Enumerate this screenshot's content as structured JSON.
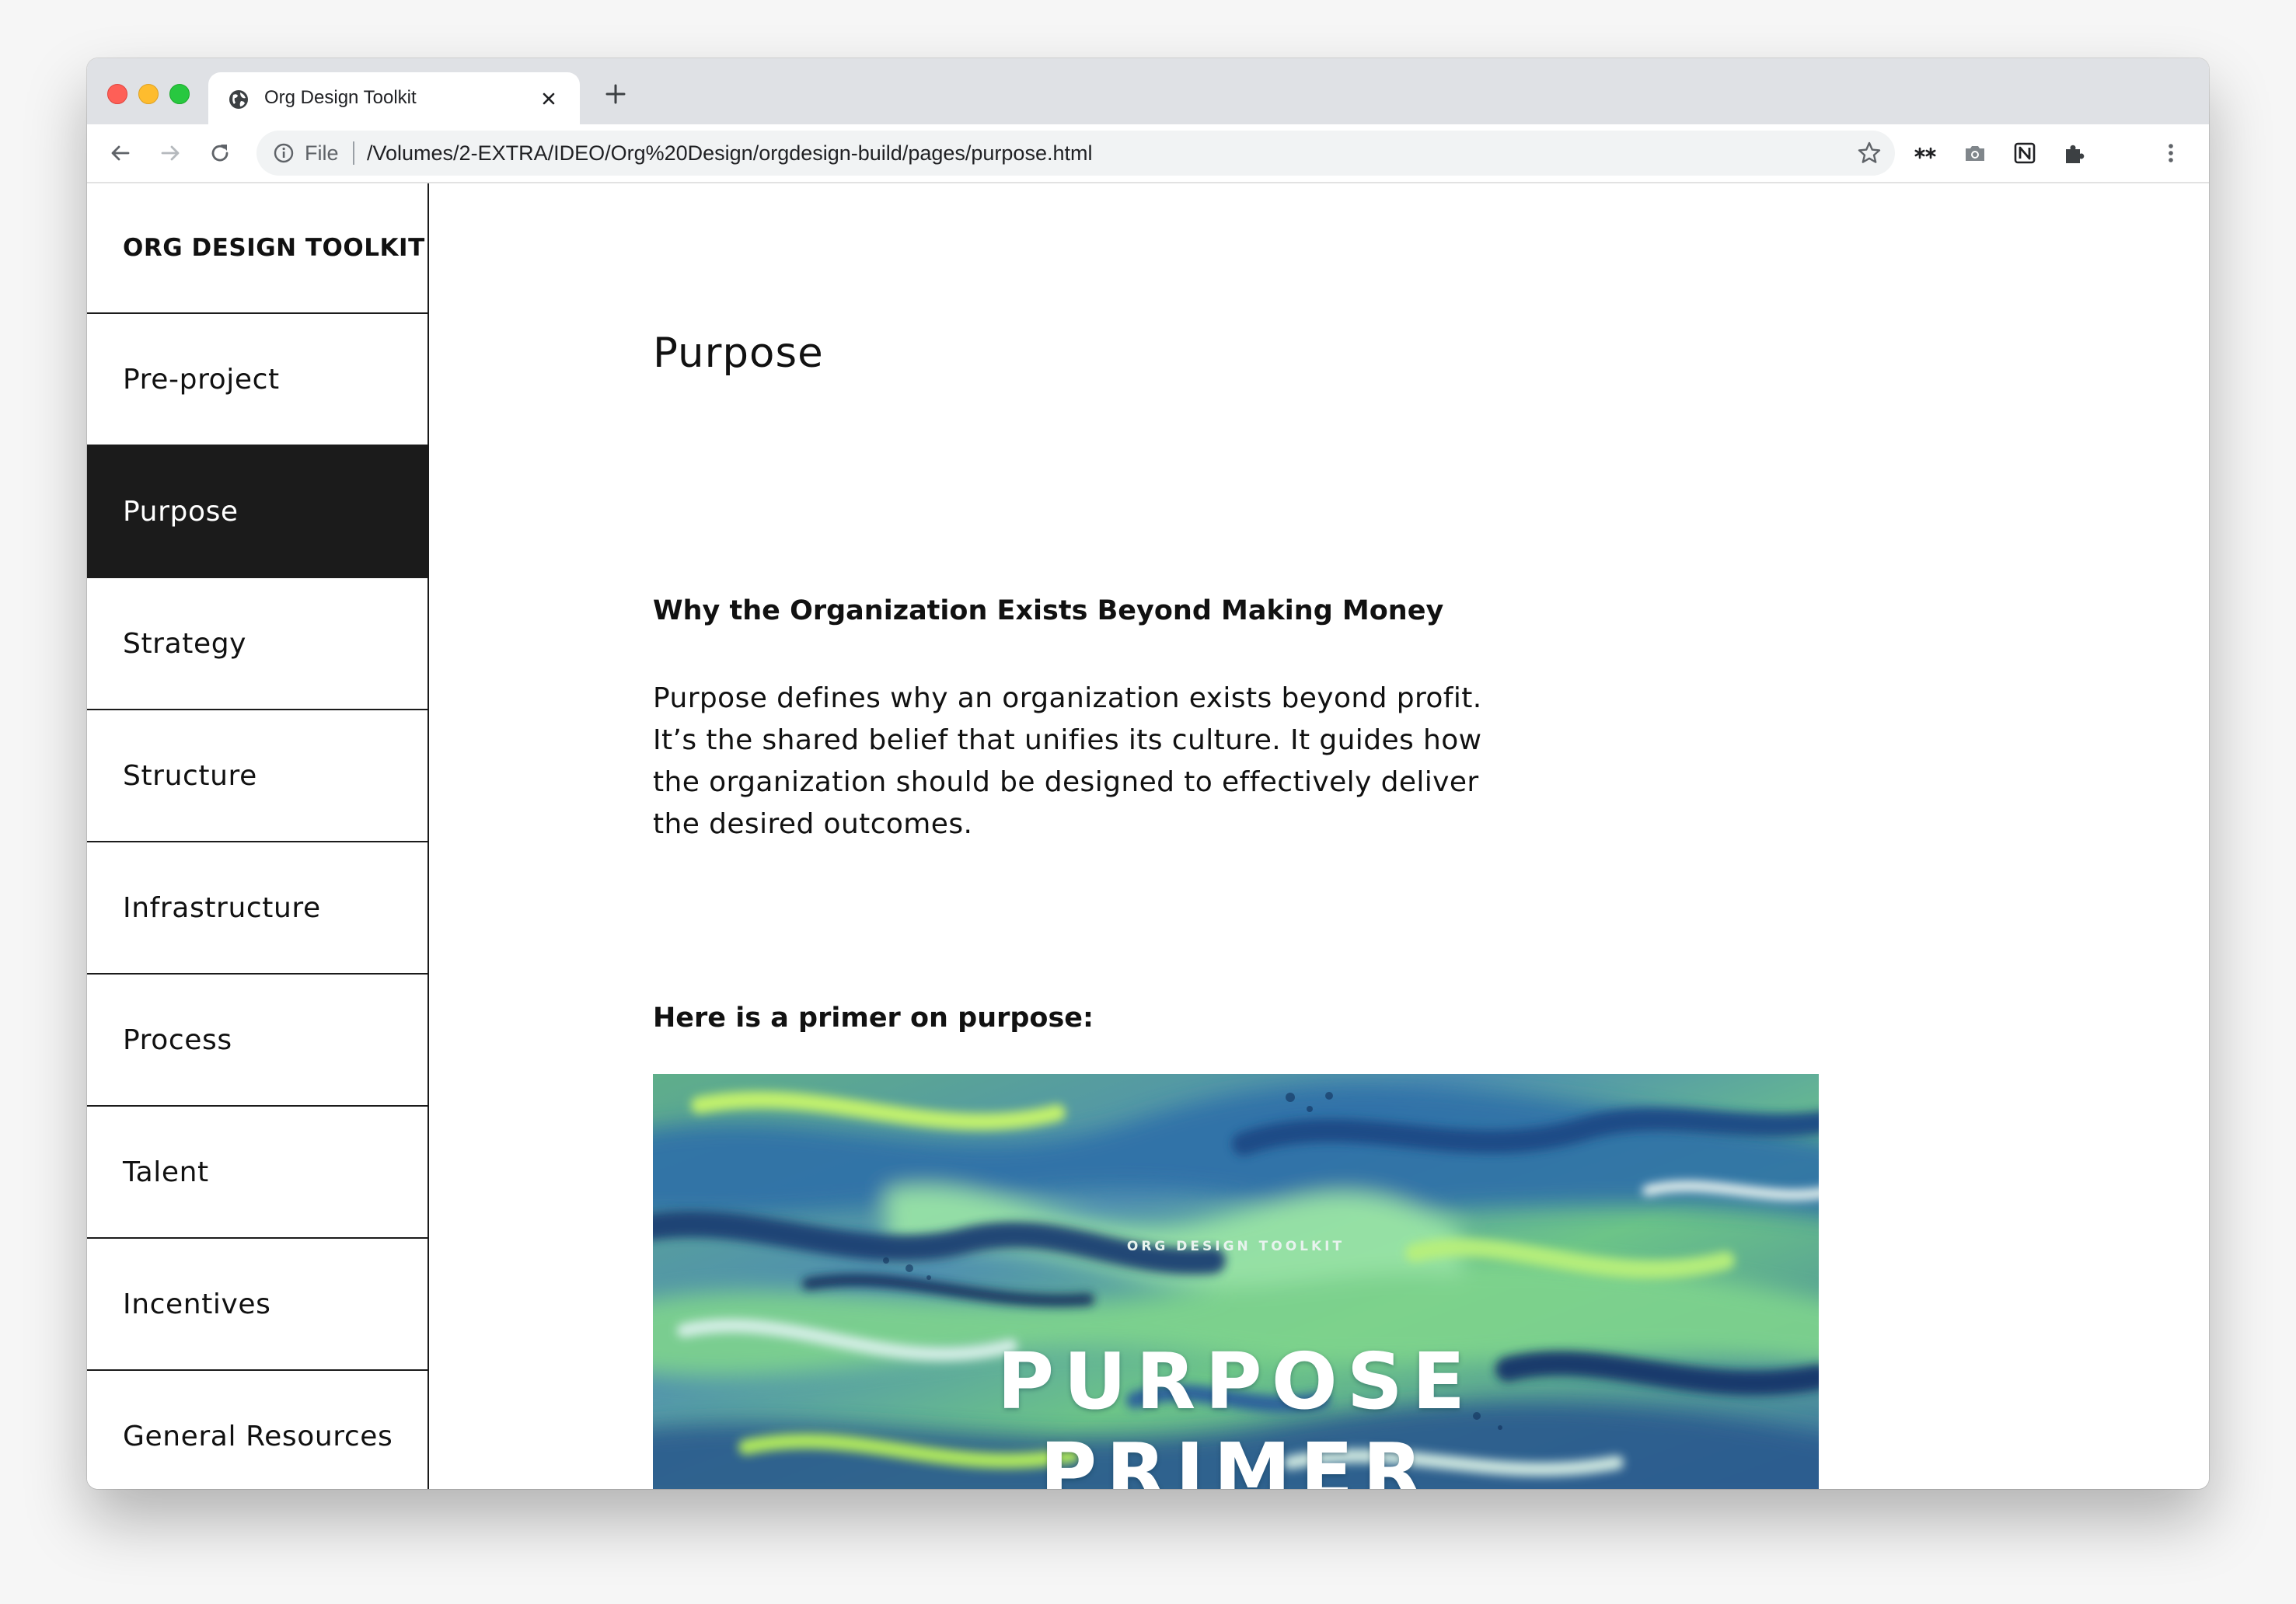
{
  "browser": {
    "tab_title": "Org Design Toolkit",
    "address_scheme": "File",
    "address_url": "/Volumes/2-EXTRA/IDEO/Org%20Design/orgdesign-build/pages/purpose.html"
  },
  "sidebar": {
    "brand": "ORG DESIGN TOOLKIT",
    "items": [
      {
        "label": "Pre-project",
        "active": false
      },
      {
        "label": "Purpose",
        "active": true
      },
      {
        "label": "Strategy",
        "active": false
      },
      {
        "label": "Structure",
        "active": false
      },
      {
        "label": "Infrastructure",
        "active": false
      },
      {
        "label": "Process",
        "active": false
      },
      {
        "label": "Talent",
        "active": false
      },
      {
        "label": "Incentives",
        "active": false
      },
      {
        "label": "General Resources",
        "active": false
      }
    ]
  },
  "main": {
    "title": "Purpose",
    "subheading": "Why the Organization Exists Beyond Making Money",
    "body": "Purpose defines why an organization exists beyond profit. It’s the shared belief that unifies its culture. It guides how the organization should be designed to effectively deliver the desired outcomes.",
    "primer_label": "Here is a primer on purpose:",
    "hero": {
      "kicker": "ORG DESIGN TOOLKIT",
      "title_line1": "PURPOSE",
      "title_line2": "PRIMER"
    }
  },
  "colors": {
    "active_nav_bg": "#1b1b1b",
    "hero_green": "#6fc27d",
    "hero_blue": "#23497e",
    "hero_lime": "#b5ee5b"
  }
}
